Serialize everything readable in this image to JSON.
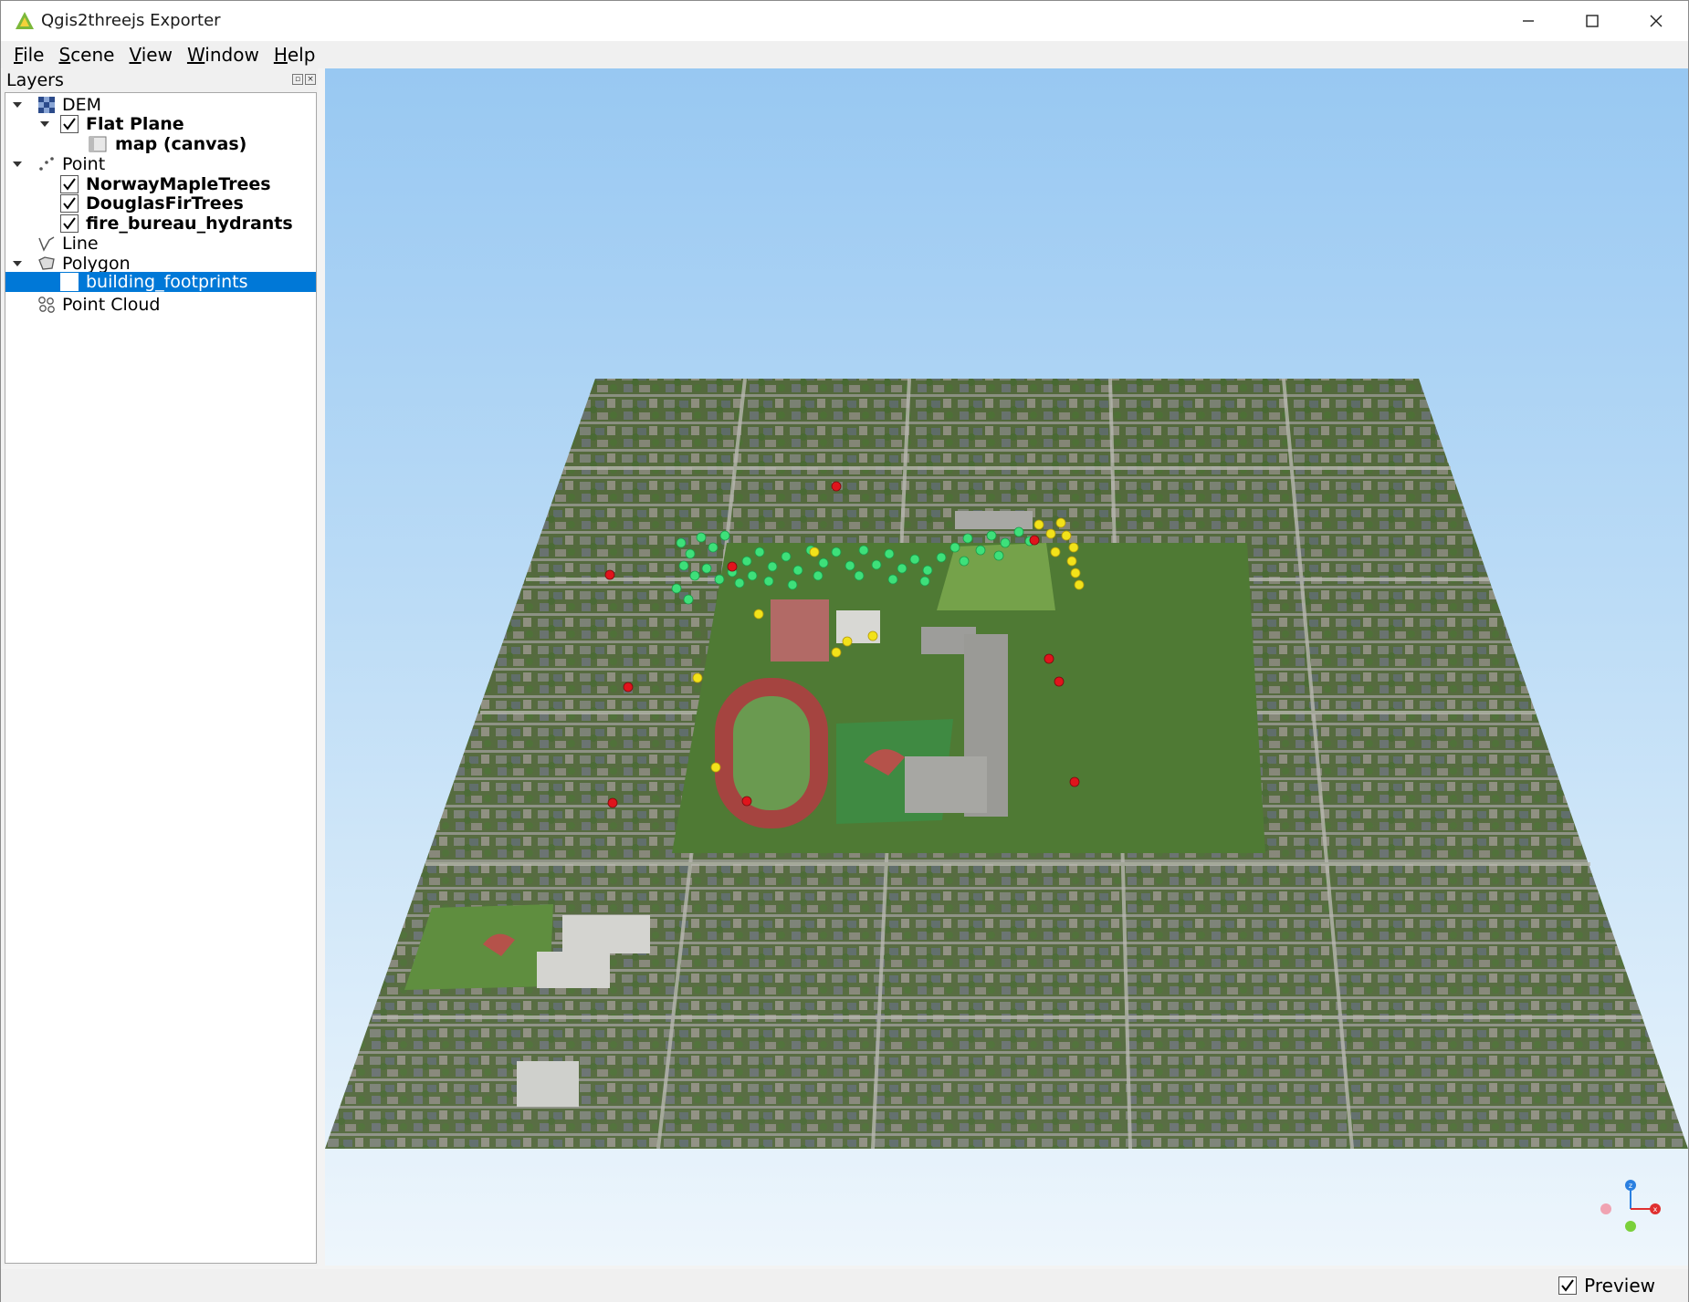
{
  "window": {
    "title": "Qgis2threejs Exporter",
    "controls": [
      "minimize",
      "maximize",
      "close"
    ]
  },
  "menubar": {
    "items": [
      {
        "label": "File",
        "mnemonic": "F",
        "rest": "ile"
      },
      {
        "label": "Scene",
        "mnemonic": "S",
        "rest": "cene"
      },
      {
        "label": "View",
        "mnemonic": "V",
        "rest": "iew"
      },
      {
        "label": "Window",
        "mnemonic": "W",
        "rest": "indow"
      },
      {
        "label": "Help",
        "mnemonic": "H",
        "rest": "elp"
      }
    ]
  },
  "layers_panel": {
    "title": "Layers",
    "tree": [
      {
        "label": "DEM",
        "expanded": true,
        "icon": "raster-icon",
        "type": "group"
      },
      {
        "label": "Flat Plane",
        "expanded": true,
        "checked": true,
        "bold": true,
        "type": "layer"
      },
      {
        "label": "map (canvas)",
        "bold": true,
        "icon": "map-canvas-icon",
        "type": "material"
      },
      {
        "label": "Point",
        "expanded": true,
        "icon": "point-icon",
        "type": "group"
      },
      {
        "label": "NorwayMapleTrees",
        "checked": true,
        "bold": true,
        "type": "layer"
      },
      {
        "label": "DouglasFirTrees",
        "checked": true,
        "bold": true,
        "type": "layer"
      },
      {
        "label": "fire_bureau_hydrants",
        "checked": true,
        "bold": true,
        "type": "layer"
      },
      {
        "label": "Line",
        "icon": "line-icon",
        "type": "group"
      },
      {
        "label": "Polygon",
        "expanded": true,
        "icon": "polygon-icon",
        "type": "group"
      },
      {
        "label": "building_footprints",
        "checked": false,
        "selected": true,
        "type": "layer"
      },
      {
        "label": "Point Cloud",
        "icon": "point-cloud-icon",
        "type": "group"
      }
    ]
  },
  "viewport": {
    "sky_top": "#98c8f2",
    "sky_bottom": "#eef6fc",
    "ground_color": "#5e6b47",
    "layer_colors": {
      "NorwayMapleTrees": "#3ee07a",
      "DouglasFirTrees": "#f2e21a",
      "fire_bureau_hydrants": "#e0141c"
    },
    "axes": {
      "x": "x",
      "z": "z"
    }
  },
  "statusbar": {
    "preview_label": "Preview",
    "preview_checked": true
  }
}
